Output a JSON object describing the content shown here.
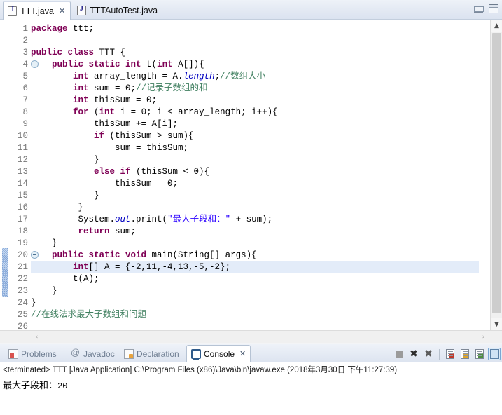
{
  "window": {
    "minimize_label": "Minimize",
    "maximize_label": "Maximize"
  },
  "editor": {
    "tabs": [
      {
        "label": "TTT.java",
        "icon": "java-file-icon",
        "active": true,
        "close_glyph": "✕"
      },
      {
        "label": "TTTAutoTest.java",
        "icon": "java-file-icon",
        "active": false,
        "close_glyph": ""
      }
    ],
    "highlighted_line": 21,
    "changed_lines": [
      20,
      21,
      22,
      23
    ],
    "fold_lines": [
      4,
      20
    ],
    "line_numbers": [
      1,
      2,
      3,
      4,
      5,
      6,
      7,
      8,
      9,
      10,
      11,
      12,
      13,
      14,
      15,
      16,
      17,
      18,
      19,
      20,
      21,
      22,
      23,
      24,
      25,
      26
    ],
    "lines": [
      {
        "n": 1,
        "segments": [
          {
            "t": "package ",
            "c": "kw"
          },
          {
            "t": "ttt;",
            "c": ""
          }
        ]
      },
      {
        "n": 2,
        "segments": []
      },
      {
        "n": 3,
        "segments": [
          {
            "t": "public class ",
            "c": "kw"
          },
          {
            "t": "TTT {",
            "c": ""
          }
        ]
      },
      {
        "n": 4,
        "segments": [
          {
            "t": "    ",
            "c": ""
          },
          {
            "t": "public static int ",
            "c": "kw"
          },
          {
            "t": "t(",
            "c": ""
          },
          {
            "t": "int ",
            "c": "kw"
          },
          {
            "t": "A[]){",
            "c": ""
          }
        ]
      },
      {
        "n": 5,
        "segments": [
          {
            "t": "        ",
            "c": ""
          },
          {
            "t": "int ",
            "c": "kw"
          },
          {
            "t": "array_length = A.",
            "c": ""
          },
          {
            "t": "length",
            "c": "fld"
          },
          {
            "t": ";",
            "c": ""
          },
          {
            "t": "//数组大小",
            "c": "cmt"
          }
        ]
      },
      {
        "n": 6,
        "segments": [
          {
            "t": "        ",
            "c": ""
          },
          {
            "t": "int ",
            "c": "kw"
          },
          {
            "t": "sum = 0;",
            "c": ""
          },
          {
            "t": "//记录子数组的和",
            "c": "cmt"
          }
        ]
      },
      {
        "n": 7,
        "segments": [
          {
            "t": "        ",
            "c": ""
          },
          {
            "t": "int ",
            "c": "kw"
          },
          {
            "t": "thisSum = 0;",
            "c": ""
          }
        ]
      },
      {
        "n": 8,
        "segments": [
          {
            "t": "        ",
            "c": ""
          },
          {
            "t": "for ",
            "c": "kw"
          },
          {
            "t": "(",
            "c": ""
          },
          {
            "t": "int ",
            "c": "kw"
          },
          {
            "t": "i = 0; i < array_length; i++){",
            "c": ""
          }
        ]
      },
      {
        "n": 9,
        "segments": [
          {
            "t": "            thisSum += A[i];",
            "c": ""
          }
        ]
      },
      {
        "n": 10,
        "segments": [
          {
            "t": "            ",
            "c": ""
          },
          {
            "t": "if ",
            "c": "kw"
          },
          {
            "t": "(thisSum > sum){",
            "c": ""
          }
        ]
      },
      {
        "n": 11,
        "segments": [
          {
            "t": "                sum = thisSum;",
            "c": ""
          }
        ]
      },
      {
        "n": 12,
        "segments": [
          {
            "t": "            }",
            "c": ""
          }
        ]
      },
      {
        "n": 13,
        "segments": [
          {
            "t": "            ",
            "c": ""
          },
          {
            "t": "else if ",
            "c": "kw"
          },
          {
            "t": "(thisSum < 0){",
            "c": ""
          }
        ]
      },
      {
        "n": 14,
        "segments": [
          {
            "t": "                thisSum = 0;",
            "c": ""
          }
        ]
      },
      {
        "n": 15,
        "segments": [
          {
            "t": "            }",
            "c": ""
          }
        ]
      },
      {
        "n": 16,
        "segments": [
          {
            "t": "         }",
            "c": ""
          }
        ]
      },
      {
        "n": 17,
        "segments": [
          {
            "t": "         System.",
            "c": ""
          },
          {
            "t": "out",
            "c": "fld"
          },
          {
            "t": ".print(",
            "c": ""
          },
          {
            "t": "\"最大子段和：\"",
            "c": "str"
          },
          {
            "t": " + sum);",
            "c": ""
          }
        ]
      },
      {
        "n": 18,
        "segments": [
          {
            "t": "         ",
            "c": ""
          },
          {
            "t": "return ",
            "c": "kw"
          },
          {
            "t": "sum;",
            "c": ""
          }
        ]
      },
      {
        "n": 19,
        "segments": [
          {
            "t": "    }",
            "c": ""
          }
        ]
      },
      {
        "n": 20,
        "segments": [
          {
            "t": "    ",
            "c": ""
          },
          {
            "t": "public static void ",
            "c": "kw"
          },
          {
            "t": "main(String[] args){",
            "c": ""
          }
        ]
      },
      {
        "n": 21,
        "segments": [
          {
            "t": "        ",
            "c": ""
          },
          {
            "t": "int",
            "c": "kw"
          },
          {
            "t": "[] A = {-2,11,-4,13,-5,-2};",
            "c": ""
          }
        ]
      },
      {
        "n": 22,
        "segments": [
          {
            "t": "        t(A);",
            "c": ""
          }
        ]
      },
      {
        "n": 23,
        "segments": [
          {
            "t": "    }",
            "c": ""
          }
        ]
      },
      {
        "n": 24,
        "segments": [
          {
            "t": "}",
            "c": ""
          }
        ]
      },
      {
        "n": 25,
        "segments": [
          {
            "t": "//在线法求最大子数组和问题",
            "c": "cmt"
          }
        ]
      },
      {
        "n": 26,
        "segments": []
      }
    ],
    "vscroll": {
      "up_glyph": "▲",
      "down_glyph": "▼"
    },
    "hscroll": {
      "left_glyph": "‹",
      "right_glyph": "›"
    }
  },
  "bottom_panel": {
    "tabs": [
      {
        "label": "Problems",
        "icon": "problems-icon",
        "active": false,
        "close_glyph": ""
      },
      {
        "label": "Javadoc",
        "icon": "javadoc-icon",
        "active": false,
        "close_glyph": ""
      },
      {
        "label": "Declaration",
        "icon": "declaration-icon",
        "active": false,
        "close_glyph": ""
      },
      {
        "label": "Console",
        "icon": "console-icon",
        "active": true,
        "close_glyph": "✕"
      }
    ],
    "toolbar": [
      {
        "name": "terminate-button",
        "glyph": ""
      },
      {
        "name": "terminate-all-button",
        "glyph": "✖"
      },
      {
        "name": "remove-all-terminated-button",
        "glyph": "✖"
      },
      {
        "name": "clear-console-button",
        "glyph": ""
      },
      {
        "name": "scroll-lock-button",
        "glyph": ""
      },
      {
        "name": "word-wrap-button",
        "glyph": ""
      },
      {
        "name": "pin-console-button",
        "glyph": ""
      }
    ],
    "console": {
      "process_line": "<terminated> TTT [Java Application] C:\\Program Files (x86)\\Java\\bin\\javaw.exe (2018年3月30日 下午11:27:39)",
      "output_text": "最大子段和：",
      "output_value": "20"
    }
  },
  "colors": {
    "keyword": "#7f0055",
    "string": "#2a00ff",
    "comment": "#3f7f5f",
    "field": "#0000c0",
    "highlight_row": "#e3ecf9",
    "tab_bar": "#e3e9f3"
  }
}
